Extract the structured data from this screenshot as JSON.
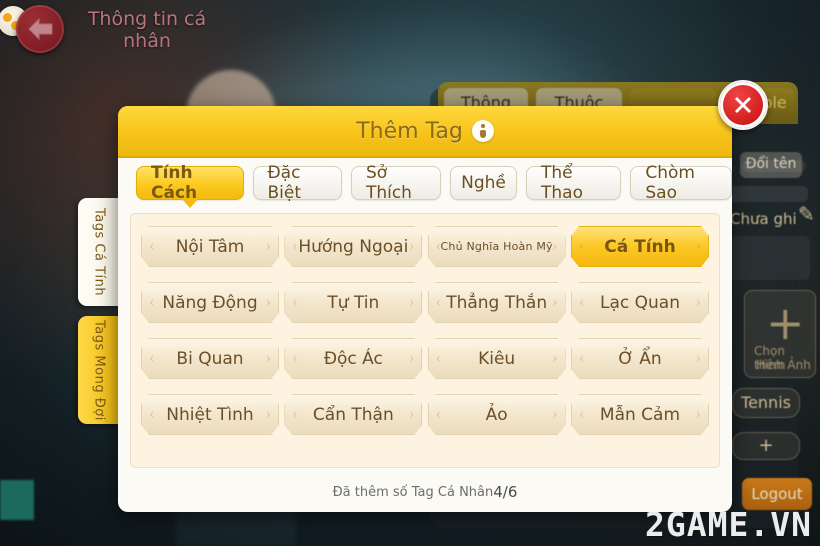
{
  "header": {
    "title": "Thông tin cá nhân",
    "back_icon": "back-arrow-icon",
    "coin_icon": "coin-icon"
  },
  "dialog": {
    "title": "Thêm Tag",
    "info_icon": "info-icon",
    "close_icon": "close-icon",
    "category_tabs": [
      {
        "label": "Tính Cách",
        "active": true
      },
      {
        "label": "Đặc Biệt",
        "active": false
      },
      {
        "label": "Sở Thích",
        "active": false
      },
      {
        "label": "Nghề",
        "active": false
      },
      {
        "label": "Thể Thao",
        "active": false
      },
      {
        "label": "Chòm Sao",
        "active": false
      }
    ],
    "tag_rows": [
      [
        {
          "label": "Nội Tâm",
          "selected": false,
          "small": false
        },
        {
          "label": "Hướng Ngoại",
          "selected": false,
          "small": false
        },
        {
          "label": "Chủ Nghĩa Hoàn Mỹ",
          "selected": false,
          "small": true
        },
        {
          "label": "Cá Tính",
          "selected": true,
          "small": false
        }
      ],
      [
        {
          "label": "Năng Động",
          "selected": false,
          "small": false
        },
        {
          "label": "Tự Tin",
          "selected": false,
          "small": false
        },
        {
          "label": "Thẳng Thắn",
          "selected": false,
          "small": false
        },
        {
          "label": "Lạc Quan",
          "selected": false,
          "small": false
        }
      ],
      [
        {
          "label": "Bi Quan",
          "selected": false,
          "small": false
        },
        {
          "label": "Độc Ác",
          "selected": false,
          "small": false
        },
        {
          "label": "Kiêu",
          "selected": false,
          "small": false
        },
        {
          "label": "Ở Ẩn",
          "selected": false,
          "small": false
        }
      ],
      [
        {
          "label": "Nhiệt Tình",
          "selected": false,
          "small": false
        },
        {
          "label": "Cẩn Thận",
          "selected": false,
          "small": false
        },
        {
          "label": "Ảo",
          "selected": false,
          "small": false
        },
        {
          "label": "Mẫn Cảm",
          "selected": false,
          "small": false
        }
      ]
    ],
    "footer_text": "Đã thêm số Tag Cá Nhân",
    "footer_count": "4/6",
    "chevron_left": "‹",
    "chevron_right": "›"
  },
  "side_tabs": [
    {
      "label": "Tags Cá Tính",
      "active": true
    },
    {
      "label": "Tags Mong Đợi",
      "active": false
    }
  ],
  "background": {
    "tabs": [
      {
        "label": "Thông"
      },
      {
        "label": "Thuộc"
      },
      {
        "label": ""
      },
      {
        "label": "Couple"
      }
    ],
    "rename_button": "Đổi tên",
    "note_value": "Chưa ghi",
    "pencil_icon": "pencil-icon",
    "add_photo_label_line1": "Chọn thêm",
    "add_photo_label_line2": "Hình Ảnh",
    "sport_tag": "Tennis",
    "add_tag_glyph": "+",
    "logout_button": "Logout"
  },
  "watermark": "2GAME.VN",
  "colors": {
    "dialog_header_gold": "#f7c41b",
    "selected_tag_gold": "#fcc928",
    "tags_panel_cream": "#fdf3e0",
    "close_red": "#d32020",
    "title_brown": "#8a6b12"
  }
}
